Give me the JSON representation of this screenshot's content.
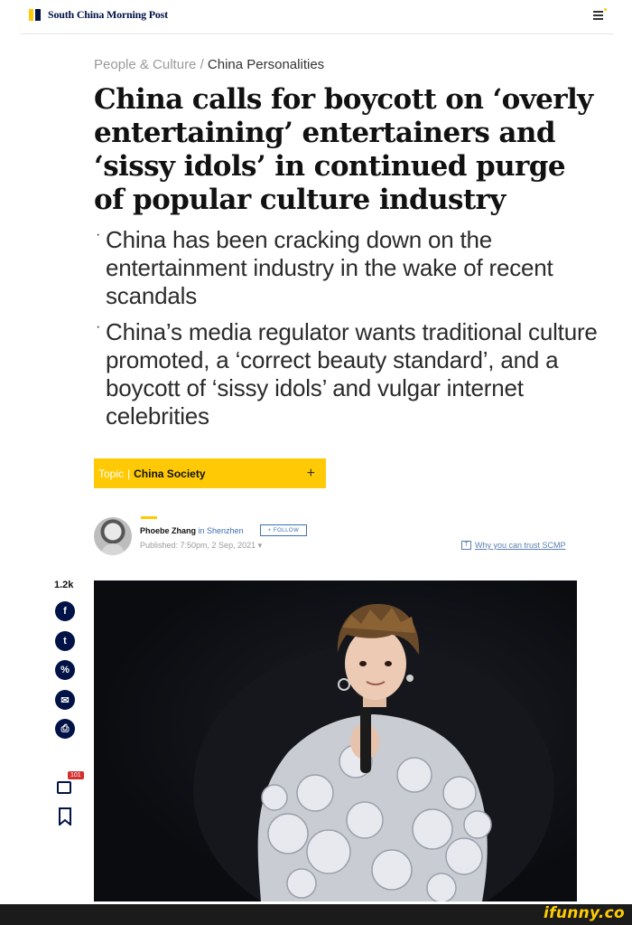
{
  "header": {
    "brand": "South China Morning Post",
    "menu_icon": "hamburger-menu-icon"
  },
  "breadcrumb": {
    "section": "People & Culture /",
    "subsection": "China Personalities"
  },
  "headline": "China calls for boycott on ‘overly entertaining’ entertainers and ‘sissy idols’ in continued purge of popular culture industry",
  "summary": [
    "China has been cracking down on the entertainment industry in the wake of recent scandals",
    "China’s media regulator wants traditional culture promoted, a ‘correct beauty standard’, and a boycott of ‘sissy idols’ and vulgar internet celebrities"
  ],
  "topic": {
    "tag": "Topic",
    "name": "China Society",
    "action": "+"
  },
  "author": {
    "name": "Phoebe Zhang",
    "location": "in Shenzhen",
    "follow_label": "+ FOLLOW",
    "published": "Published: 7:50pm, 2 Sep, 2021 ▾",
    "trust_label": "Why you can trust SCMP",
    "trust_icon": "T"
  },
  "share": {
    "count": "1.2k",
    "buttons": [
      {
        "name": "facebook-icon",
        "glyph": "f"
      },
      {
        "name": "twitter-icon",
        "glyph": "t"
      },
      {
        "name": "link-icon",
        "glyph": "%"
      },
      {
        "name": "email-icon",
        "glyph": "✉"
      },
      {
        "name": "print-icon",
        "glyph": "⎙"
      }
    ],
    "comment_count": "101"
  },
  "watermark": "ifunny.co",
  "colors": {
    "brand_navy": "#001246",
    "brand_yellow": "#ffca05",
    "link_blue": "#3d6fb0"
  }
}
